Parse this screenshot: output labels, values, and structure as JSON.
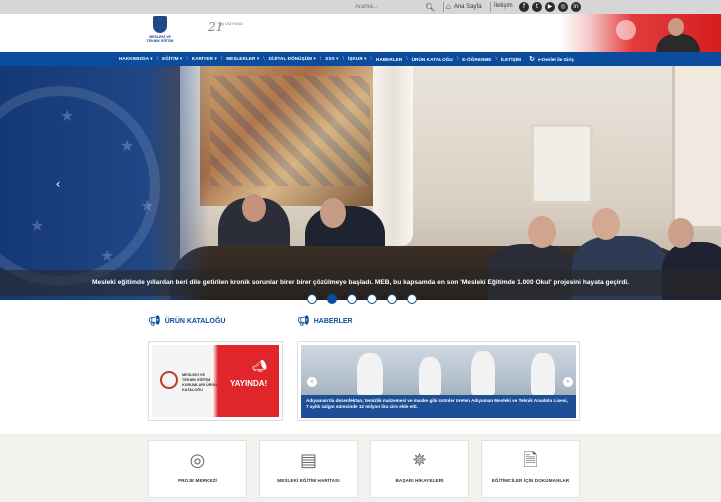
{
  "topbar": {
    "search_placeholder": "Arama...",
    "home_label": "Ana Sayfa",
    "contact_label": "İletişim",
    "social_icons": [
      "facebook-icon",
      "twitter-icon",
      "youtube-icon",
      "instagram-icon",
      "linkedin-icon"
    ]
  },
  "header": {
    "logo_text": "MESLEKİ VE TEKNİK EĞİTİM",
    "anniversary_number": "21",
    "anniversary_text": "yy VİZYONU"
  },
  "nav": {
    "items": [
      {
        "label": "HAKKIMIZDA ▾"
      },
      {
        "label": "EĞİTİM ▾"
      },
      {
        "label": "KARİYER ▾"
      },
      {
        "label": "MESLEKLER ▾"
      },
      {
        "label": "DİJİTAL DÖNÜŞÜM ▾"
      },
      {
        "label": "SSS ▾"
      },
      {
        "label": "İŞKUR ▾"
      },
      {
        "label": "HABERLER"
      },
      {
        "label": "ÜRÜN KATALOĞU"
      },
      {
        "label": "E-ÖĞRENME"
      },
      {
        "label": "İLETİŞİM"
      }
    ],
    "edevlet_label": "e-Devlet ile Giriş"
  },
  "hero": {
    "caption": "Mesleki eğitimde yıllardan beri dile getirilen kronik sorunlar birer birer çözülmeye başladı. MEB, bu kapsamda en son 'Mesleki Eğitimde 1.000 Okul' projesini hayata geçirdi.",
    "prev_label": "‹",
    "next_label": "›",
    "slide_count": 6,
    "active_slide": 2
  },
  "sections": {
    "catalog_title": "ÜRÜN KATALOĞU",
    "news_title": "HABERLER"
  },
  "catalog_card": {
    "label": "MESLEKİ VE TEKNİK EĞİTİM KURUMLARI ÜRÜN KATALOĞU",
    "badge": "YAYINDA!"
  },
  "news_card": {
    "caption": "Adıyaman'da dezenfektan, temizlik malzemesi ve maske gibi ürünler üreten Adıyaman Mesleki ve Teknik Anadolu Lisesi, 7 aylık salgın sürecinde 12 milyon lira ciro elde etti.",
    "prev_label": "‹",
    "next_label": "›"
  },
  "tiles": [
    {
      "label": "PROJE MERKEZİ",
      "icon": "target-icon"
    },
    {
      "label": "MESLEKİ EĞİTİM HARİTASI",
      "icon": "monitor-chart-icon"
    },
    {
      "label": "BAŞARI HİKAYELERİ",
      "icon": "award-badge-icon"
    },
    {
      "label": "EĞİTİMCİLER İÇİN DOKÜMANLAR",
      "icon": "document-icon"
    }
  ],
  "colors": {
    "nav_blue": "#0b4d9c",
    "accent_red": "#e0252b",
    "band_bg": "#f2f1ed"
  }
}
